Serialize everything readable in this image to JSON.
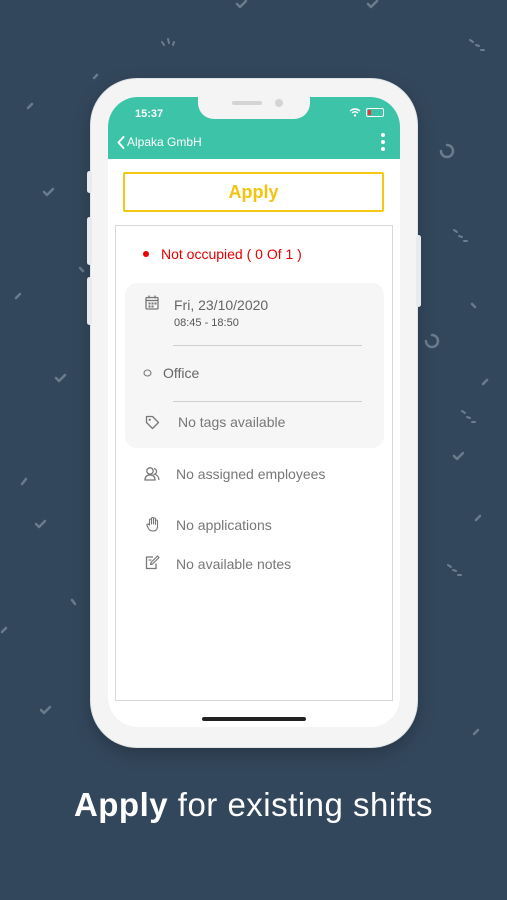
{
  "status_bar": {
    "time": "15:37"
  },
  "app_bar": {
    "back_label": "Alpaka GmbH"
  },
  "apply_button": {
    "label": "Apply"
  },
  "shift": {
    "status": "Not occupied ( 0 Of 1 )",
    "date": "Fri, 23/10/2020",
    "time_range": "08:45 - 18:50",
    "location": "Office",
    "tags": "No tags available",
    "employees": "No assigned employees",
    "applications": "No applications",
    "notes": "No available notes"
  },
  "caption": {
    "bold": "Apply",
    "rest": " for existing shifts"
  },
  "colors": {
    "background": "#33475c",
    "app_bar": "#3dc3a8",
    "apply_accent": "#f2c40f",
    "status_red": "#e60000"
  },
  "icons": [
    "back-chevron-icon",
    "more-vert-icon",
    "wifi-icon",
    "battery-icon",
    "calendar-icon",
    "location-icon",
    "tag-icon",
    "employees-icon",
    "hand-icon",
    "note-icon"
  ]
}
